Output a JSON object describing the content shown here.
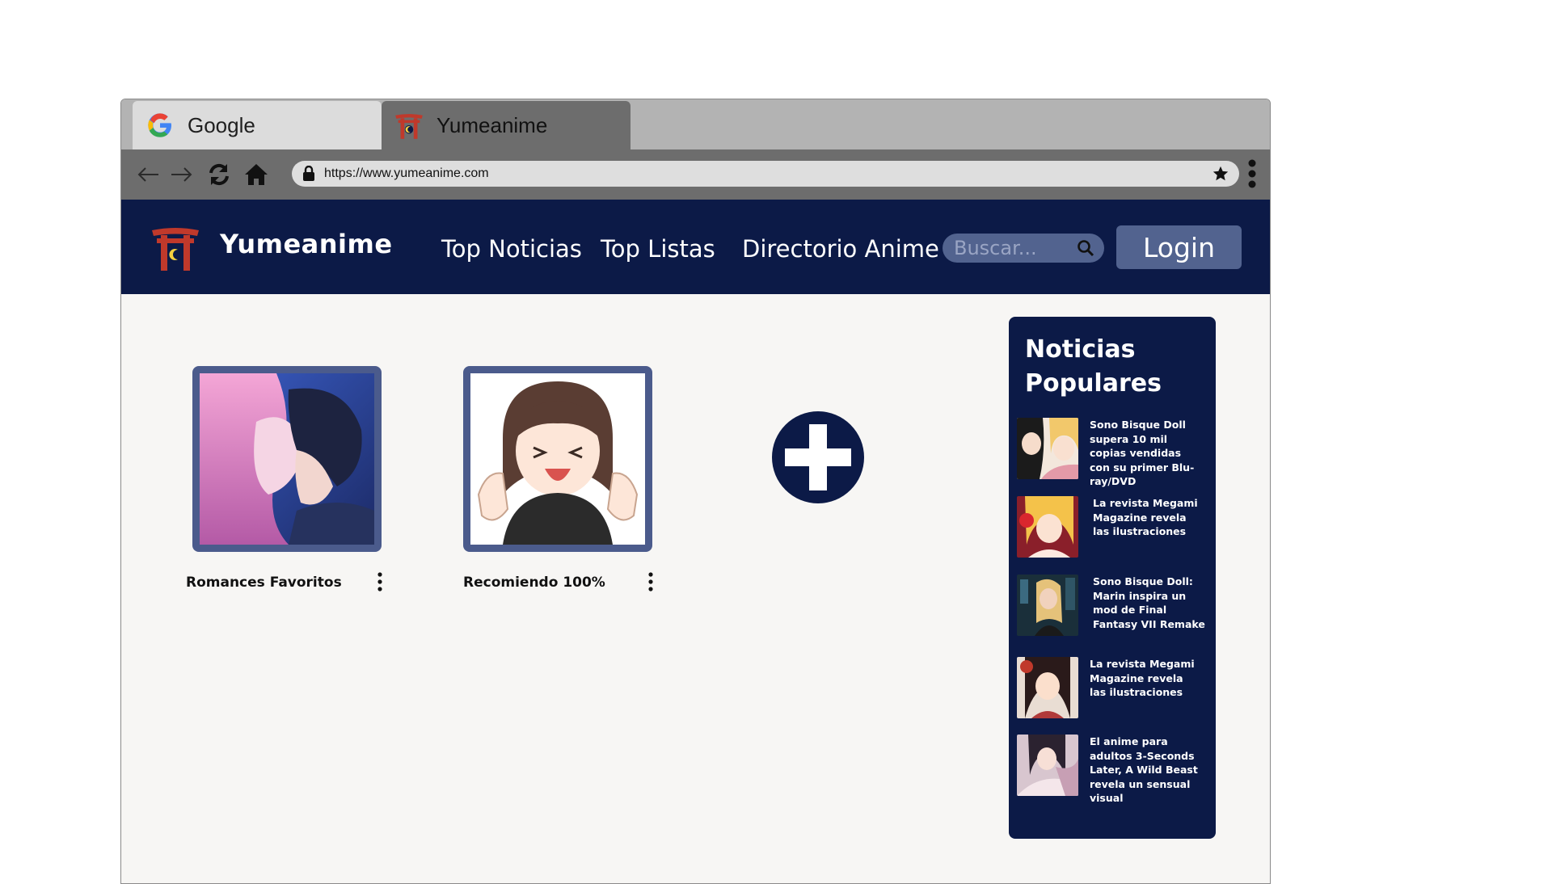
{
  "browser": {
    "tabs": [
      {
        "label": "Google",
        "icon": "google-icon"
      },
      {
        "label": "Yumeanime",
        "icon": "torii-icon"
      }
    ],
    "url": "https://www.yumeanime.com"
  },
  "header": {
    "brand": "Yumeanime",
    "nav": [
      "Top Noticias",
      "Top Listas",
      "Directorio Anime"
    ],
    "search_placeholder": "Buscar...",
    "login_label": "Login"
  },
  "lists": [
    {
      "title": "Romances Favoritos"
    },
    {
      "title": "Recomiendo 100%"
    }
  ],
  "news": {
    "heading": "Noticias Populares",
    "items": [
      {
        "text": "Sono Bisque Doll supera 10 mil copias vendidas con su primer Blu-ray/DVD"
      },
      {
        "text": "La revista Megami Magazine revela las ilustraciones"
      },
      {
        "text": "Sono Bisque Doll: Marin inspira un mod de Final Fantasy VII Remake"
      },
      {
        "text": "La revista Megami Magazine revela las ilustraciones"
      },
      {
        "text": "El anime para adultos 3-Seconds Later, A Wild Beast revela un sensual visual"
      }
    ]
  },
  "colors": {
    "navy": "#0c1a47",
    "accent": "#52638f",
    "page_bg": "#f7f6f4"
  }
}
